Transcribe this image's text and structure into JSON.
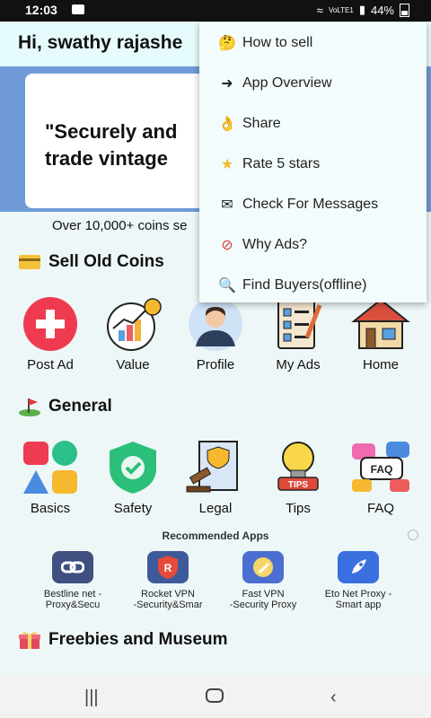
{
  "status": {
    "time": "12:03",
    "network": "VoLTE1",
    "battery": "44%"
  },
  "header": {
    "greeting": "Hi, swathy rajashe"
  },
  "banner": {
    "quote_line1": "\"Securely and",
    "quote_line2": "trade vintage",
    "subline": "Over 10,000+ coins se"
  },
  "sell_section": {
    "title": "Sell Old Coins",
    "items": [
      {
        "label": "Post Ad",
        "icon": "plus-circle-icon"
      },
      {
        "label": "Value",
        "icon": "chart-coin-icon"
      },
      {
        "label": "Profile",
        "icon": "person-icon"
      },
      {
        "label": "My Ads",
        "icon": "clipboard-icon"
      },
      {
        "label": "Home",
        "icon": "house-icon"
      }
    ]
  },
  "general_section": {
    "title": "General",
    "items": [
      {
        "label": "Basics",
        "icon": "shapes-icon"
      },
      {
        "label": "Safety",
        "icon": "shield-icon"
      },
      {
        "label": "Legal",
        "icon": "legal-icon"
      },
      {
        "label": "Tips",
        "icon": "bulb-icon"
      },
      {
        "label": "FAQ",
        "icon": "faq-icon"
      }
    ]
  },
  "recommended": {
    "title": "Recommended Apps",
    "apps": [
      {
        "line1": "Bestline net -",
        "line2": "Proxy&Secu",
        "icon": "link-icon"
      },
      {
        "line1": "Rocket VPN",
        "line2": "-Security&Smar",
        "icon": "r-shield-icon"
      },
      {
        "line1": "Fast VPN",
        "line2": "-Security Proxy",
        "icon": "rocket-icon"
      },
      {
        "line1": "Eto Net Proxy -",
        "line2": "Smart app",
        "icon": "rocket-blue-icon"
      }
    ]
  },
  "freebies": {
    "title": "Freebies and Museum"
  },
  "menu": {
    "items": [
      {
        "label": "How to sell",
        "icon": "thinking-face-icon"
      },
      {
        "label": "App Overview",
        "icon": "login-arrow-icon"
      },
      {
        "label": "Share",
        "icon": "ok-hand-icon"
      },
      {
        "label": "Rate 5 stars",
        "icon": "star-icon"
      },
      {
        "label": "Check For Messages",
        "icon": "mail-icon"
      },
      {
        "label": "Why Ads?",
        "icon": "no-entry-icon"
      },
      {
        "label": "Find Buyers(offline)",
        "icon": "magnifier-icon"
      }
    ]
  }
}
